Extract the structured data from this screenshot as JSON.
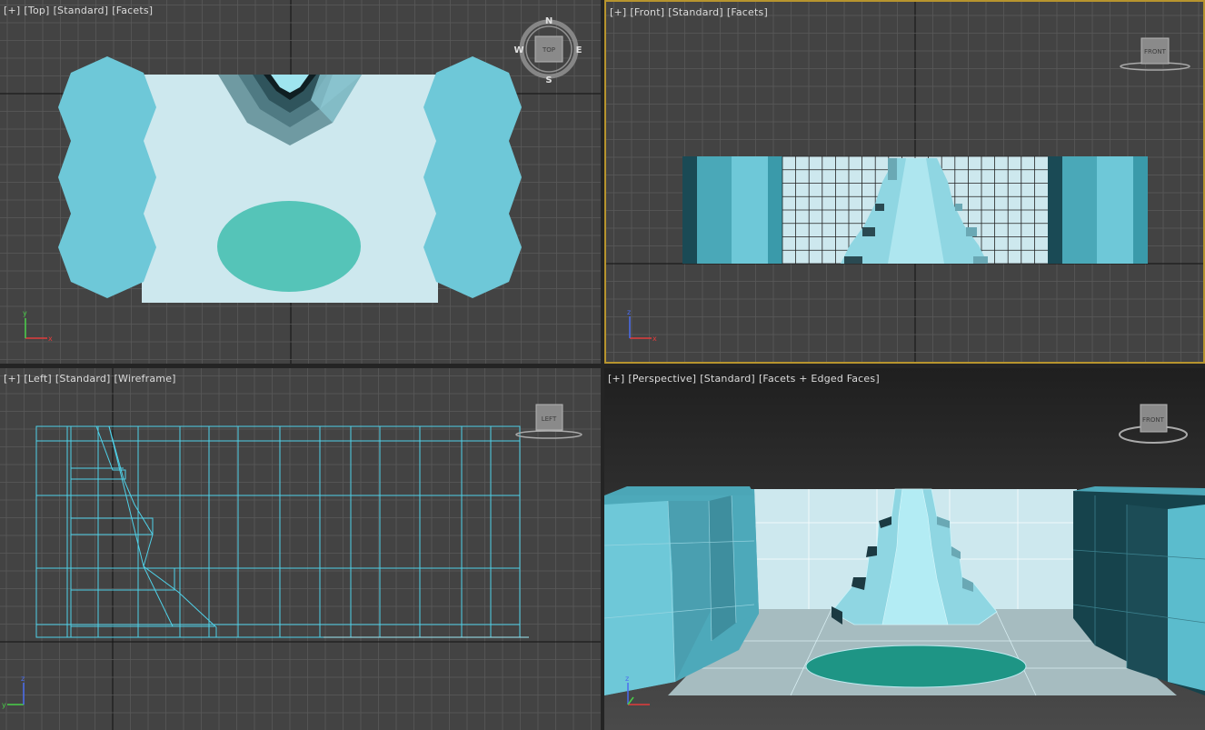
{
  "viewports": {
    "top": {
      "menu": "[+]",
      "view": "[Top]",
      "shading_preset": "[Standard]",
      "mode": "[Facets]",
      "viewcube_label": "TOP",
      "compass": {
        "n": "N",
        "s": "S",
        "e": "E",
        "w": "W"
      }
    },
    "front": {
      "menu": "[+]",
      "view": "[Front]",
      "shading_preset": "[Standard]",
      "mode": "[Facets]",
      "viewcube_label": "FRONT",
      "active": true
    },
    "left": {
      "menu": "[+]",
      "view": "[Left]",
      "shading_preset": "[Standard]",
      "mode": "[Wireframe]",
      "viewcube_label": "LEFT"
    },
    "perspective": {
      "menu": "[+]",
      "view": "[Perspective]",
      "shading_preset": "[Standard]",
      "mode": "[Facets + Edged Faces]",
      "viewcube_label": "FRONT"
    }
  },
  "axis_labels": {
    "x": "x",
    "y": "y",
    "z": "z"
  },
  "colors": {
    "viewport_bg": "#434343",
    "grid": "#5a5a5a",
    "grid_axis": "#111111",
    "active_border": "#b7942e",
    "object_light": "#cde8ee",
    "object_cyan": "#6ec8d8",
    "object_teal": "#55c4b8",
    "wire": "#4fd1e8",
    "axis_x": "#e23c3c",
    "axis_y": "#49d049",
    "axis_z": "#4a6cf0"
  }
}
